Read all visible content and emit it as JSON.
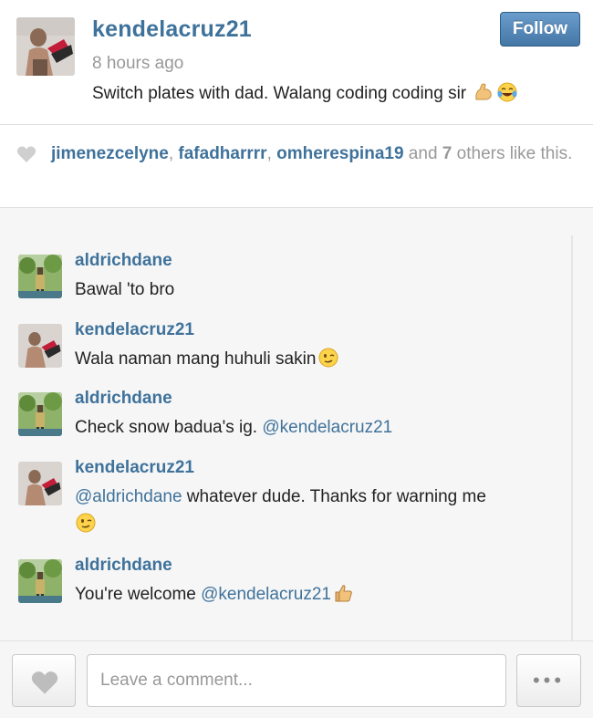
{
  "post": {
    "username": "kendelacruz21",
    "time": "8 hours ago",
    "caption": "Switch plates with dad. Walang coding coding sir",
    "caption_emojis": [
      "flexed-biceps-emoji",
      "tears-of-joy-emoji"
    ],
    "follow_label": "Follow"
  },
  "likes": {
    "users": [
      "jimenezcelyne",
      "fafadharrrr",
      "omherespina19"
    ],
    "sep1": ", ",
    "sep2": ", ",
    "and_text": " and ",
    "others_count": "7",
    "tail_text": " others like this."
  },
  "comments": [
    {
      "username": "aldrichdane",
      "text": "Bawal 'to bro"
    },
    {
      "username": "kendelacruz21",
      "text": "Wala naman mang huhuli sakin",
      "emoji": "winking-face-emoji"
    },
    {
      "username": "aldrichdane",
      "text": "Check snow badua's ig. ",
      "mention": "@kendelacruz21"
    },
    {
      "username": "kendelacruz21",
      "mention": "@aldrichdane",
      "text": " whatever dude. Thanks for warning me",
      "emoji": "winking-face-emoji"
    },
    {
      "username": "aldrichdane",
      "text": "You're welcome ",
      "mention": "@kendelacruz21",
      "emoji": "thumbs-up-emoji"
    }
  ],
  "footer": {
    "comment_placeholder": "Leave a comment...",
    "more_label": "•••"
  },
  "colors": {
    "username": "#3f729b",
    "muted": "#999999",
    "follow_button": "#4577a6",
    "comments_bg": "#f6f6f6"
  }
}
